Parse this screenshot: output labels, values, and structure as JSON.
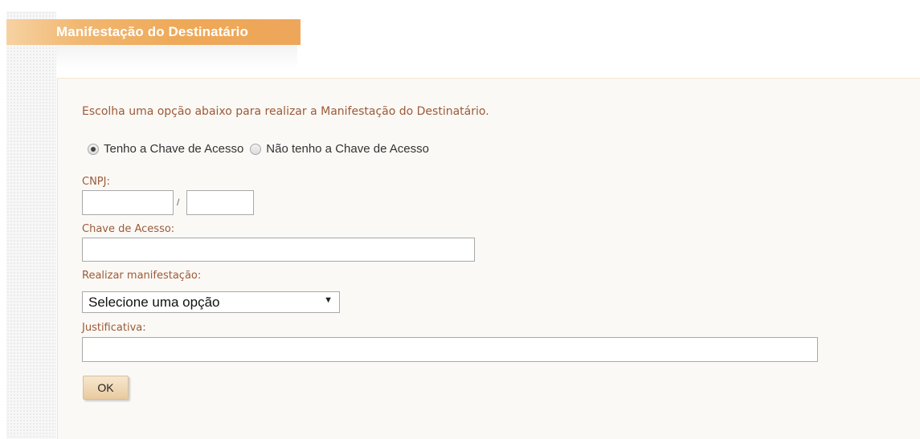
{
  "header": {
    "title": "Manifestação do Destinatário"
  },
  "intro_text": "Escolha uma opção abaixo para realizar a Manifestação do Destinatário.",
  "access_key_options": [
    {
      "label": "Tenho a Chave de Acesso",
      "checked": true
    },
    {
      "label": "Não tenho a Chave de Acesso",
      "checked": false
    }
  ],
  "form": {
    "cnpj_label": "CNPJ:",
    "cnpj_separator": "/",
    "cnpj_part1_value": "",
    "cnpj_part2_value": "",
    "chave_label": "Chave de Acesso:",
    "chave_value": "",
    "manifestacao_label": "Realizar manifestação:",
    "manifestacao_selected": "Selecione uma opção",
    "justificativa_label": "Justificativa:",
    "justificativa_value": "",
    "ok_label": "OK"
  },
  "colors": {
    "accent_orange": "#eea958",
    "label_brown": "#9c5a37",
    "panel_bg": "#fbf9f6"
  }
}
